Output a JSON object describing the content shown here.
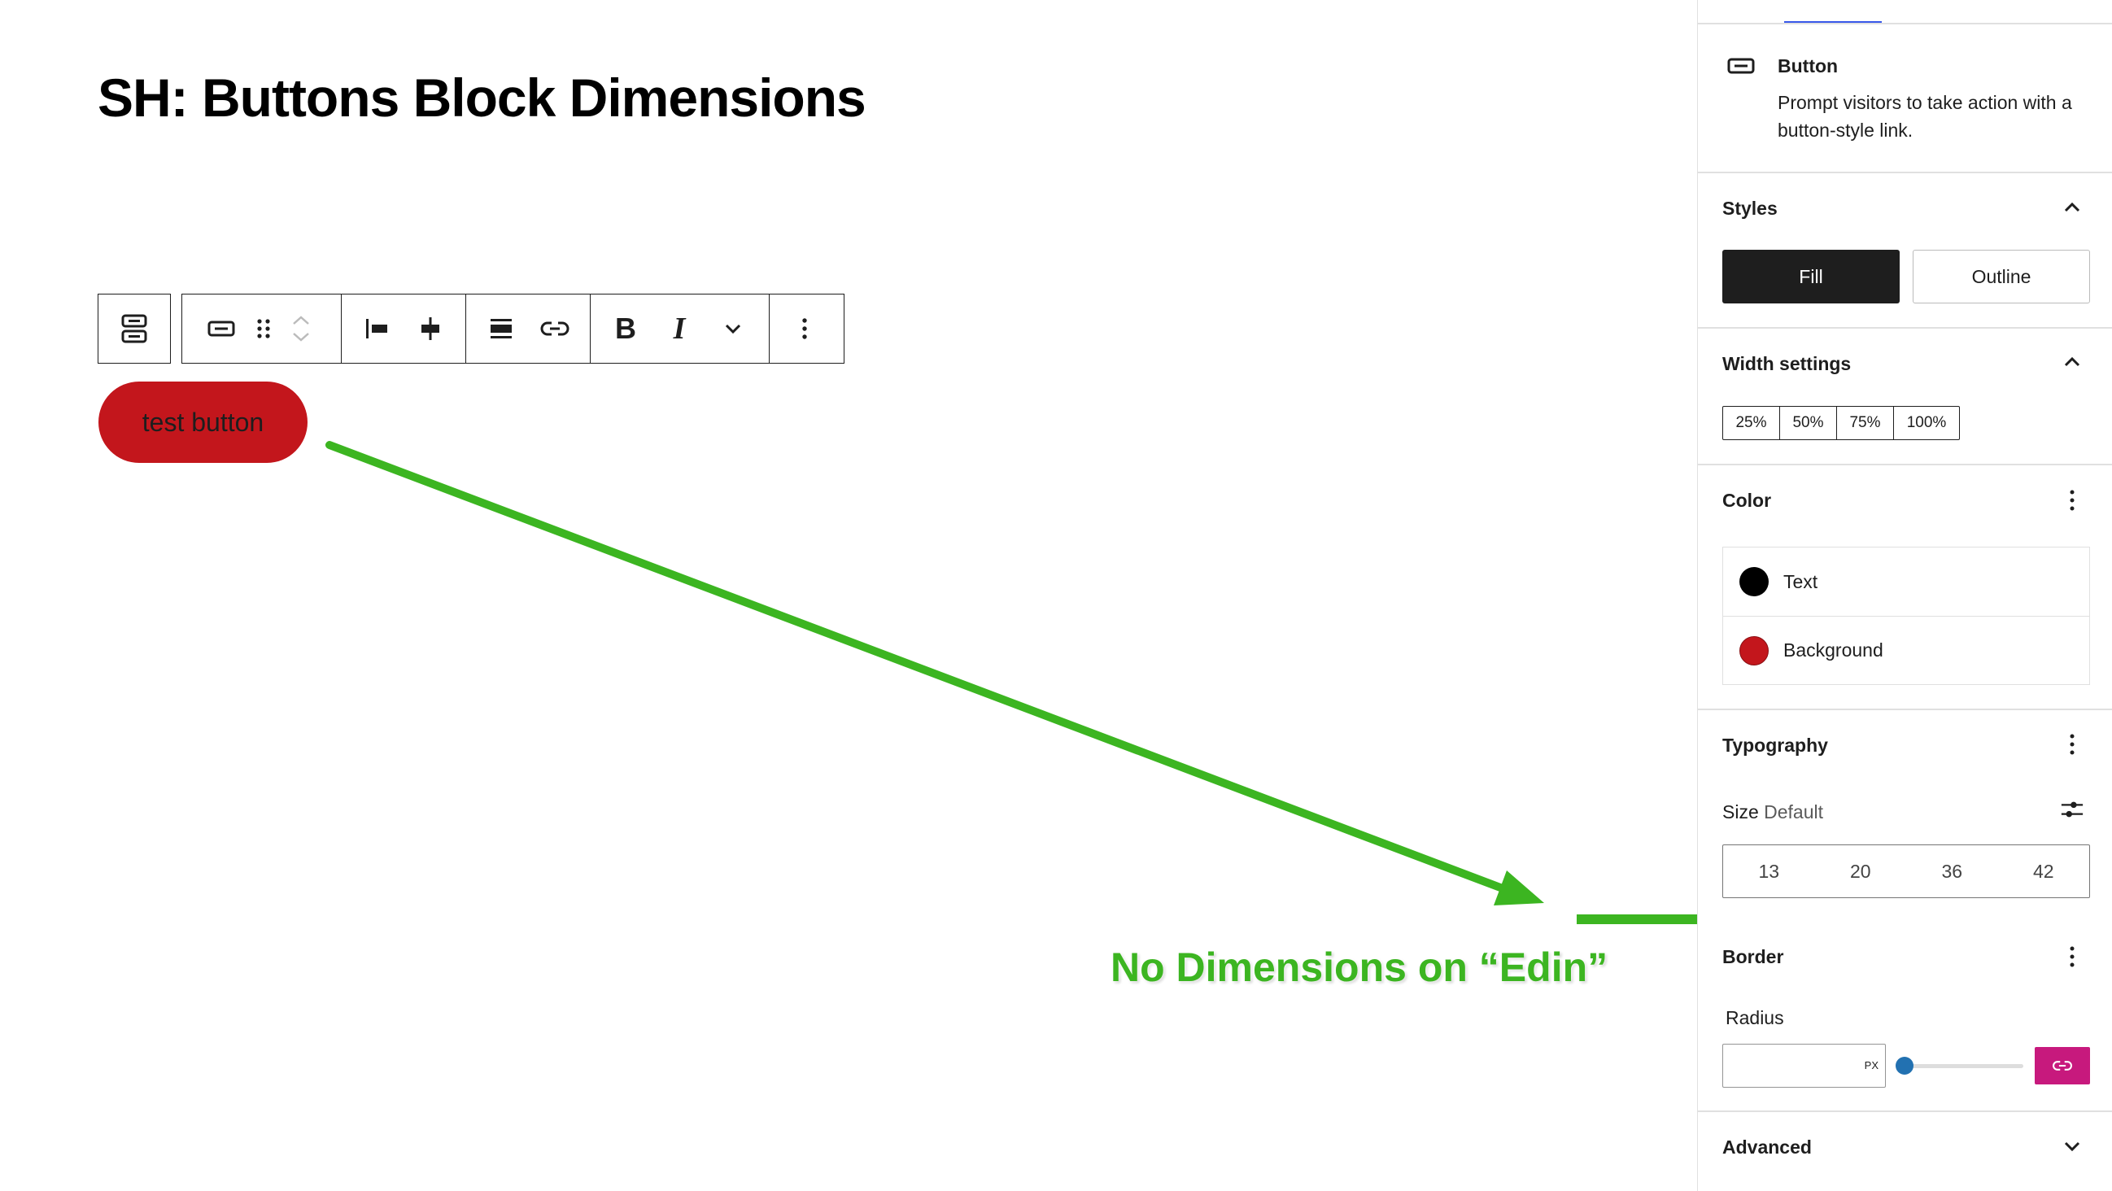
{
  "editor": {
    "post_title": "SH: Buttons Block Dimensions",
    "button_text": "test button",
    "toolbar": {
      "bold_label": "B",
      "italic_label": "I"
    }
  },
  "annotation": {
    "text": "No Dimensions on “Edin”",
    "color": "#3cb521"
  },
  "sidebar": {
    "block_card": {
      "title": "Button",
      "description": "Prompt visitors to take action with a button-style link."
    },
    "styles": {
      "title": "Styles",
      "options": [
        "Fill",
        "Outline"
      ],
      "selected": "Fill"
    },
    "width_settings": {
      "title": "Width settings",
      "options": [
        "25%",
        "50%",
        "75%",
        "100%"
      ]
    },
    "color": {
      "title": "Color",
      "items": [
        {
          "label": "Text",
          "swatch": "#000000"
        },
        {
          "label": "Background",
          "swatch": "#c3161c"
        }
      ]
    },
    "typography": {
      "title": "Typography",
      "size_label": "Size",
      "size_value": "Default",
      "sizes": [
        "13",
        "20",
        "36",
        "42"
      ]
    },
    "border": {
      "title": "Border",
      "radius_label": "Radius",
      "radius_value": "",
      "radius_unit": "PX"
    },
    "advanced": {
      "title": "Advanced"
    }
  },
  "colors": {
    "button_red": "#c3161c",
    "accent_blue": "#3858e9",
    "link_sides_pink": "#c7197d"
  }
}
